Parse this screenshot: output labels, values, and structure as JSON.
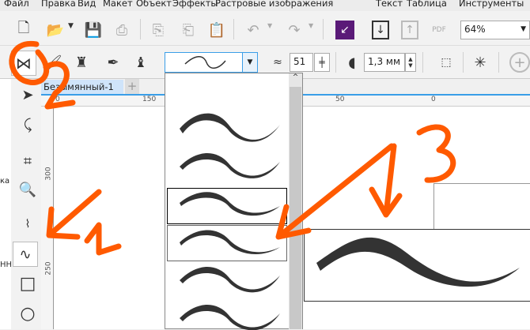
{
  "menu": [
    "Файл",
    "Правка",
    "Вид",
    "Макет",
    "Объект",
    "Эффекты",
    "Растровые изображения",
    "Текст",
    "Таблица",
    "Инструменты"
  ],
  "toolbar": {
    "zoom_value": "64%",
    "pdf_label": "PDF"
  },
  "property_bar": {
    "smoothing_value": "51",
    "width_value": "1,3 мм"
  },
  "document": {
    "tab_title": "Безымянный-1",
    "add_tab": "+"
  },
  "rulers": {
    "h_ticks": [
      "0",
      "150",
      "50",
      "0"
    ],
    "v_ticks": [
      "300",
      "250"
    ]
  },
  "left_strip": {
    "texts": [
      "ка",
      "НН"
    ]
  },
  "annotations": [
    "1",
    "2",
    "3"
  ],
  "colors": {
    "annotation": "#ff5a00",
    "accent": "#3a9ee8"
  }
}
